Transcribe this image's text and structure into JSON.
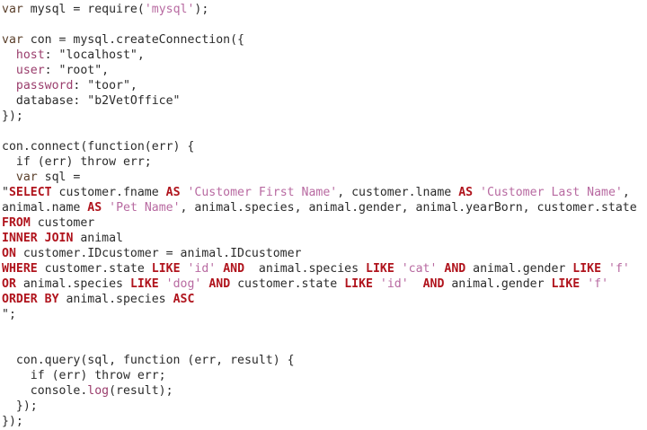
{
  "editor": {
    "lines": [
      [
        {
          "t": "var",
          "c": "kw"
        },
        {
          "t": " mysql = require(",
          "c": "plain"
        },
        {
          "t": "'mysql'",
          "c": "sqlstr"
        },
        {
          "t": ");",
          "c": "plain"
        }
      ],
      [],
      [
        {
          "t": "var",
          "c": "kw"
        },
        {
          "t": " con = mysql.createConnection({",
          "c": "plain"
        }
      ],
      [
        {
          "t": "  host",
          "c": "prop"
        },
        {
          "t": ": \"localhost\",",
          "c": "plain"
        }
      ],
      [
        {
          "t": "  user",
          "c": "prop"
        },
        {
          "t": ": \"root\",",
          "c": "plain"
        }
      ],
      [
        {
          "t": "  password",
          "c": "prop"
        },
        {
          "t": ": \"toor\",",
          "c": "plain"
        }
      ],
      [
        {
          "t": "  database: \"b2VetOffice\"",
          "c": "plain"
        }
      ],
      [
        {
          "t": "});",
          "c": "plain"
        }
      ],
      [],
      [
        {
          "t": "con.connect(function(err) {",
          "c": "plain"
        }
      ],
      [
        {
          "t": "  if (err) throw err;",
          "c": "plain"
        }
      ],
      [
        {
          "t": "  var",
          "c": "kw"
        },
        {
          "t": " sql =",
          "c": "plain"
        }
      ],
      [
        {
          "t": "\"",
          "c": "plain"
        },
        {
          "t": "SELECT",
          "c": "sqlkw"
        },
        {
          "t": " customer.fname ",
          "c": "plain"
        },
        {
          "t": "AS",
          "c": "sqlkw"
        },
        {
          "t": " ",
          "c": "plain"
        },
        {
          "t": "'Customer First Name'",
          "c": "sqlstr"
        },
        {
          "t": ", customer.lname ",
          "c": "plain"
        },
        {
          "t": "AS",
          "c": "sqlkw"
        },
        {
          "t": " ",
          "c": "plain"
        },
        {
          "t": "'Customer Last Name'",
          "c": "sqlstr"
        },
        {
          "t": ",",
          "c": "plain"
        }
      ],
      [
        {
          "t": "animal.name ",
          "c": "plain"
        },
        {
          "t": "AS",
          "c": "sqlkw"
        },
        {
          "t": " ",
          "c": "plain"
        },
        {
          "t": "'Pet Name'",
          "c": "sqlstr"
        },
        {
          "t": ", animal.species, animal.gender, animal.yearBorn, customer.state",
          "c": "plain"
        }
      ],
      [
        {
          "t": "FROM",
          "c": "sqlkw"
        },
        {
          "t": " customer",
          "c": "plain"
        }
      ],
      [
        {
          "t": "INNER JOIN",
          "c": "sqlkw"
        },
        {
          "t": " animal",
          "c": "plain"
        }
      ],
      [
        {
          "t": "ON",
          "c": "sqlkw"
        },
        {
          "t": " customer.IDcustomer = animal.IDcustomer",
          "c": "plain"
        }
      ],
      [
        {
          "t": "WHERE",
          "c": "sqlkw"
        },
        {
          "t": " customer.state ",
          "c": "plain"
        },
        {
          "t": "LIKE",
          "c": "sqlkw"
        },
        {
          "t": " ",
          "c": "plain"
        },
        {
          "t": "'id'",
          "c": "sqlstr"
        },
        {
          "t": " ",
          "c": "plain"
        },
        {
          "t": "AND",
          "c": "sqlkw"
        },
        {
          "t": "  animal.species ",
          "c": "plain"
        },
        {
          "t": "LIKE",
          "c": "sqlkw"
        },
        {
          "t": " ",
          "c": "plain"
        },
        {
          "t": "'cat'",
          "c": "sqlstr"
        },
        {
          "t": " ",
          "c": "plain"
        },
        {
          "t": "AND",
          "c": "sqlkw"
        },
        {
          "t": " animal.gender ",
          "c": "plain"
        },
        {
          "t": "LIKE",
          "c": "sqlkw"
        },
        {
          "t": " ",
          "c": "plain"
        },
        {
          "t": "'f'",
          "c": "sqlstr"
        }
      ],
      [
        {
          "t": "OR",
          "c": "sqlkw"
        },
        {
          "t": " animal.species ",
          "c": "plain"
        },
        {
          "t": "LIKE",
          "c": "sqlkw"
        },
        {
          "t": " ",
          "c": "plain"
        },
        {
          "t": "'dog'",
          "c": "sqlstr"
        },
        {
          "t": " ",
          "c": "plain"
        },
        {
          "t": "AND",
          "c": "sqlkw"
        },
        {
          "t": " customer.state ",
          "c": "plain"
        },
        {
          "t": "LIKE",
          "c": "sqlkw"
        },
        {
          "t": " ",
          "c": "plain"
        },
        {
          "t": "'id'",
          "c": "sqlstr"
        },
        {
          "t": "  ",
          "c": "plain"
        },
        {
          "t": "AND",
          "c": "sqlkw"
        },
        {
          "t": " animal.gender ",
          "c": "plain"
        },
        {
          "t": "LIKE",
          "c": "sqlkw"
        },
        {
          "t": " ",
          "c": "plain"
        },
        {
          "t": "'f'",
          "c": "sqlstr"
        }
      ],
      [
        {
          "t": "ORDER BY",
          "c": "sqlkw"
        },
        {
          "t": " animal.species ",
          "c": "plain"
        },
        {
          "t": "ASC",
          "c": "sqlkw"
        }
      ],
      [
        {
          "t": "\";",
          "c": "plain"
        }
      ],
      [],
      [],
      [
        {
          "t": "  con.query(sql, function (err, result) {",
          "c": "plain"
        }
      ],
      [
        {
          "t": "    if (err) throw err;",
          "c": "plain"
        }
      ],
      [
        {
          "t": "    console.",
          "c": "plain"
        },
        {
          "t": "log",
          "c": "prop"
        },
        {
          "t": "(result);",
          "c": "plain"
        }
      ],
      [
        {
          "t": "  });",
          "c": "plain"
        }
      ],
      [
        {
          "t": "});",
          "c": "plain"
        }
      ]
    ]
  }
}
